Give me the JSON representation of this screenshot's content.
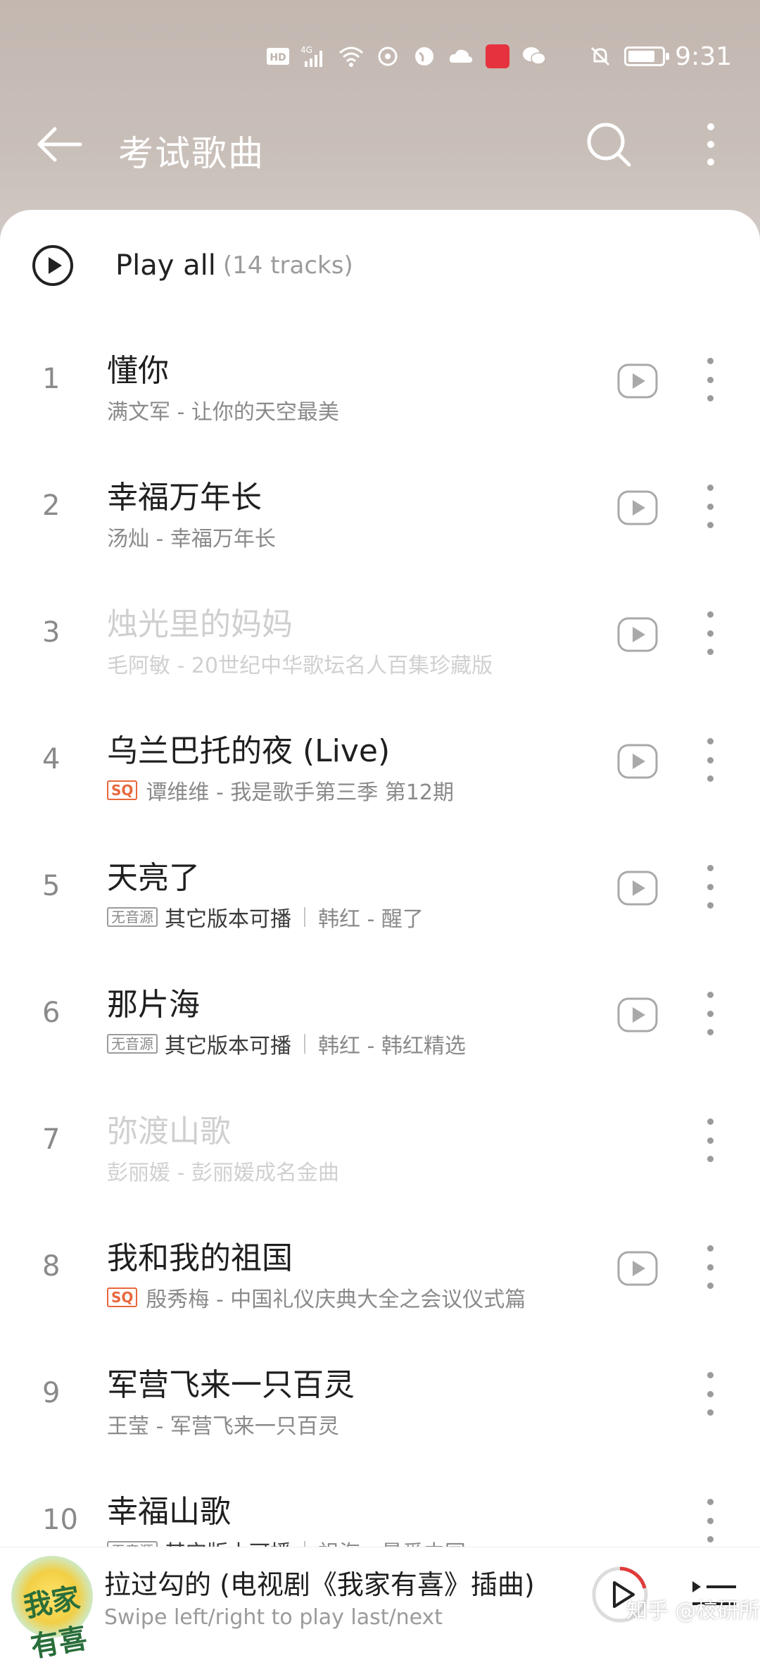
{
  "status_bar": {
    "time": "9:31",
    "network": "HD 4G",
    "icons": [
      "hd-icon",
      "4g-signal-icon",
      "wifi-icon",
      "sync-icon",
      "globe-icon",
      "cloud-icon",
      "book-app-icon",
      "wechat-icon",
      "mute-icon",
      "battery-icon"
    ]
  },
  "header": {
    "title": "考试歌曲"
  },
  "play_all": {
    "label": "Play all",
    "count": "(14 tracks)"
  },
  "tracks": [
    {
      "num": "1",
      "title": "懂你",
      "sub": "满文军 - 让你的天空最美",
      "badge": "",
      "playable": true,
      "dim": false
    },
    {
      "num": "2",
      "title": "幸福万年长",
      "sub": "汤灿 - 幸福万年长",
      "badge": "",
      "playable": true,
      "dim": false
    },
    {
      "num": "3",
      "title": "烛光里的妈妈",
      "sub": "毛阿敏 - 20世纪中华歌坛名人百集珍藏版",
      "badge": "",
      "playable": true,
      "dim": true
    },
    {
      "num": "4",
      "title": "乌兰巴托的夜 (Live)",
      "sub": "谭维维 - 我是歌手第三季 第12期",
      "badge": "SQ",
      "playable": true,
      "dim": false
    },
    {
      "num": "5",
      "title": "天亮了",
      "sub": "韩红 - 醒了",
      "badge": "无音源",
      "other": "其它版本可播",
      "playable": true,
      "dim": false
    },
    {
      "num": "6",
      "title": "那片海",
      "sub": "韩红 - 韩红精选",
      "badge": "无音源",
      "other": "其它版本可播",
      "playable": true,
      "dim": false
    },
    {
      "num": "7",
      "title": "弥渡山歌",
      "sub": "彭丽媛 - 彭丽媛成名金曲",
      "badge": "",
      "playable": false,
      "dim": true
    },
    {
      "num": "8",
      "title": "我和我的祖国",
      "sub": "殷秀梅 - 中国礼仪庆典大全之会议仪式篇",
      "badge": "SQ",
      "playable": true,
      "dim": false
    },
    {
      "num": "9",
      "title": "军营飞来一只百灵",
      "sub": "王莹 - 军营飞来一只百灵",
      "badge": "",
      "playable": false,
      "dim": false
    },
    {
      "num": "10",
      "title": "幸福山歌",
      "sub": "祖海 - 最爱中国",
      "badge": "无音源",
      "other": "其它版本可播",
      "playable": false,
      "dim": false
    }
  ],
  "now_playing": {
    "title": "拉过勾的 (电视剧《我家有喜》插曲)",
    "hint": "Swipe left/right to play last/next",
    "cover_text": "我家有喜"
  },
  "watermark": "知乎 @校研所",
  "colors": {
    "header_bg": "#c5bab3",
    "accent_red": "#e13b3b",
    "sq_badge": "#e8683c",
    "text_primary": "#1f1f1f",
    "text_secondary": "#8a8a8a",
    "text_disabled": "#cfcfcf"
  }
}
